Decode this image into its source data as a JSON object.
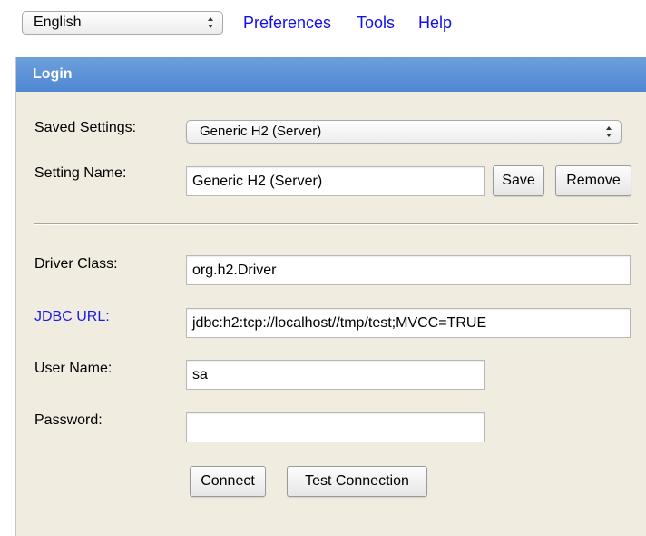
{
  "topbar": {
    "language": "English",
    "links": {
      "preferences": "Preferences",
      "tools": "Tools",
      "help": "Help"
    }
  },
  "login": {
    "title": "Login",
    "saved_settings_label": "Saved Settings:",
    "saved_settings_value": "Generic H2 (Server)",
    "setting_name_label": "Setting Name:",
    "setting_name_value": "Generic H2 (Server)",
    "save_label": "Save",
    "remove_label": "Remove",
    "driver_class_label": "Driver Class:",
    "driver_class_value": "org.h2.Driver",
    "jdbc_url_label": "JDBC URL:",
    "jdbc_url_value": "jdbc:h2:tcp://localhost//tmp/test;MVCC=TRUE",
    "user_name_label": "User Name:",
    "user_name_value": "sa",
    "password_label": "Password:",
    "password_value": "",
    "connect_label": "Connect",
    "test_connection_label": "Test Connection"
  },
  "colors": {
    "header_blue": "#5a90d6",
    "panel_bg": "#f0ece0",
    "link_blue": "#1111ee"
  },
  "icons": {
    "select_arrows": "up-down-arrows-icon"
  }
}
